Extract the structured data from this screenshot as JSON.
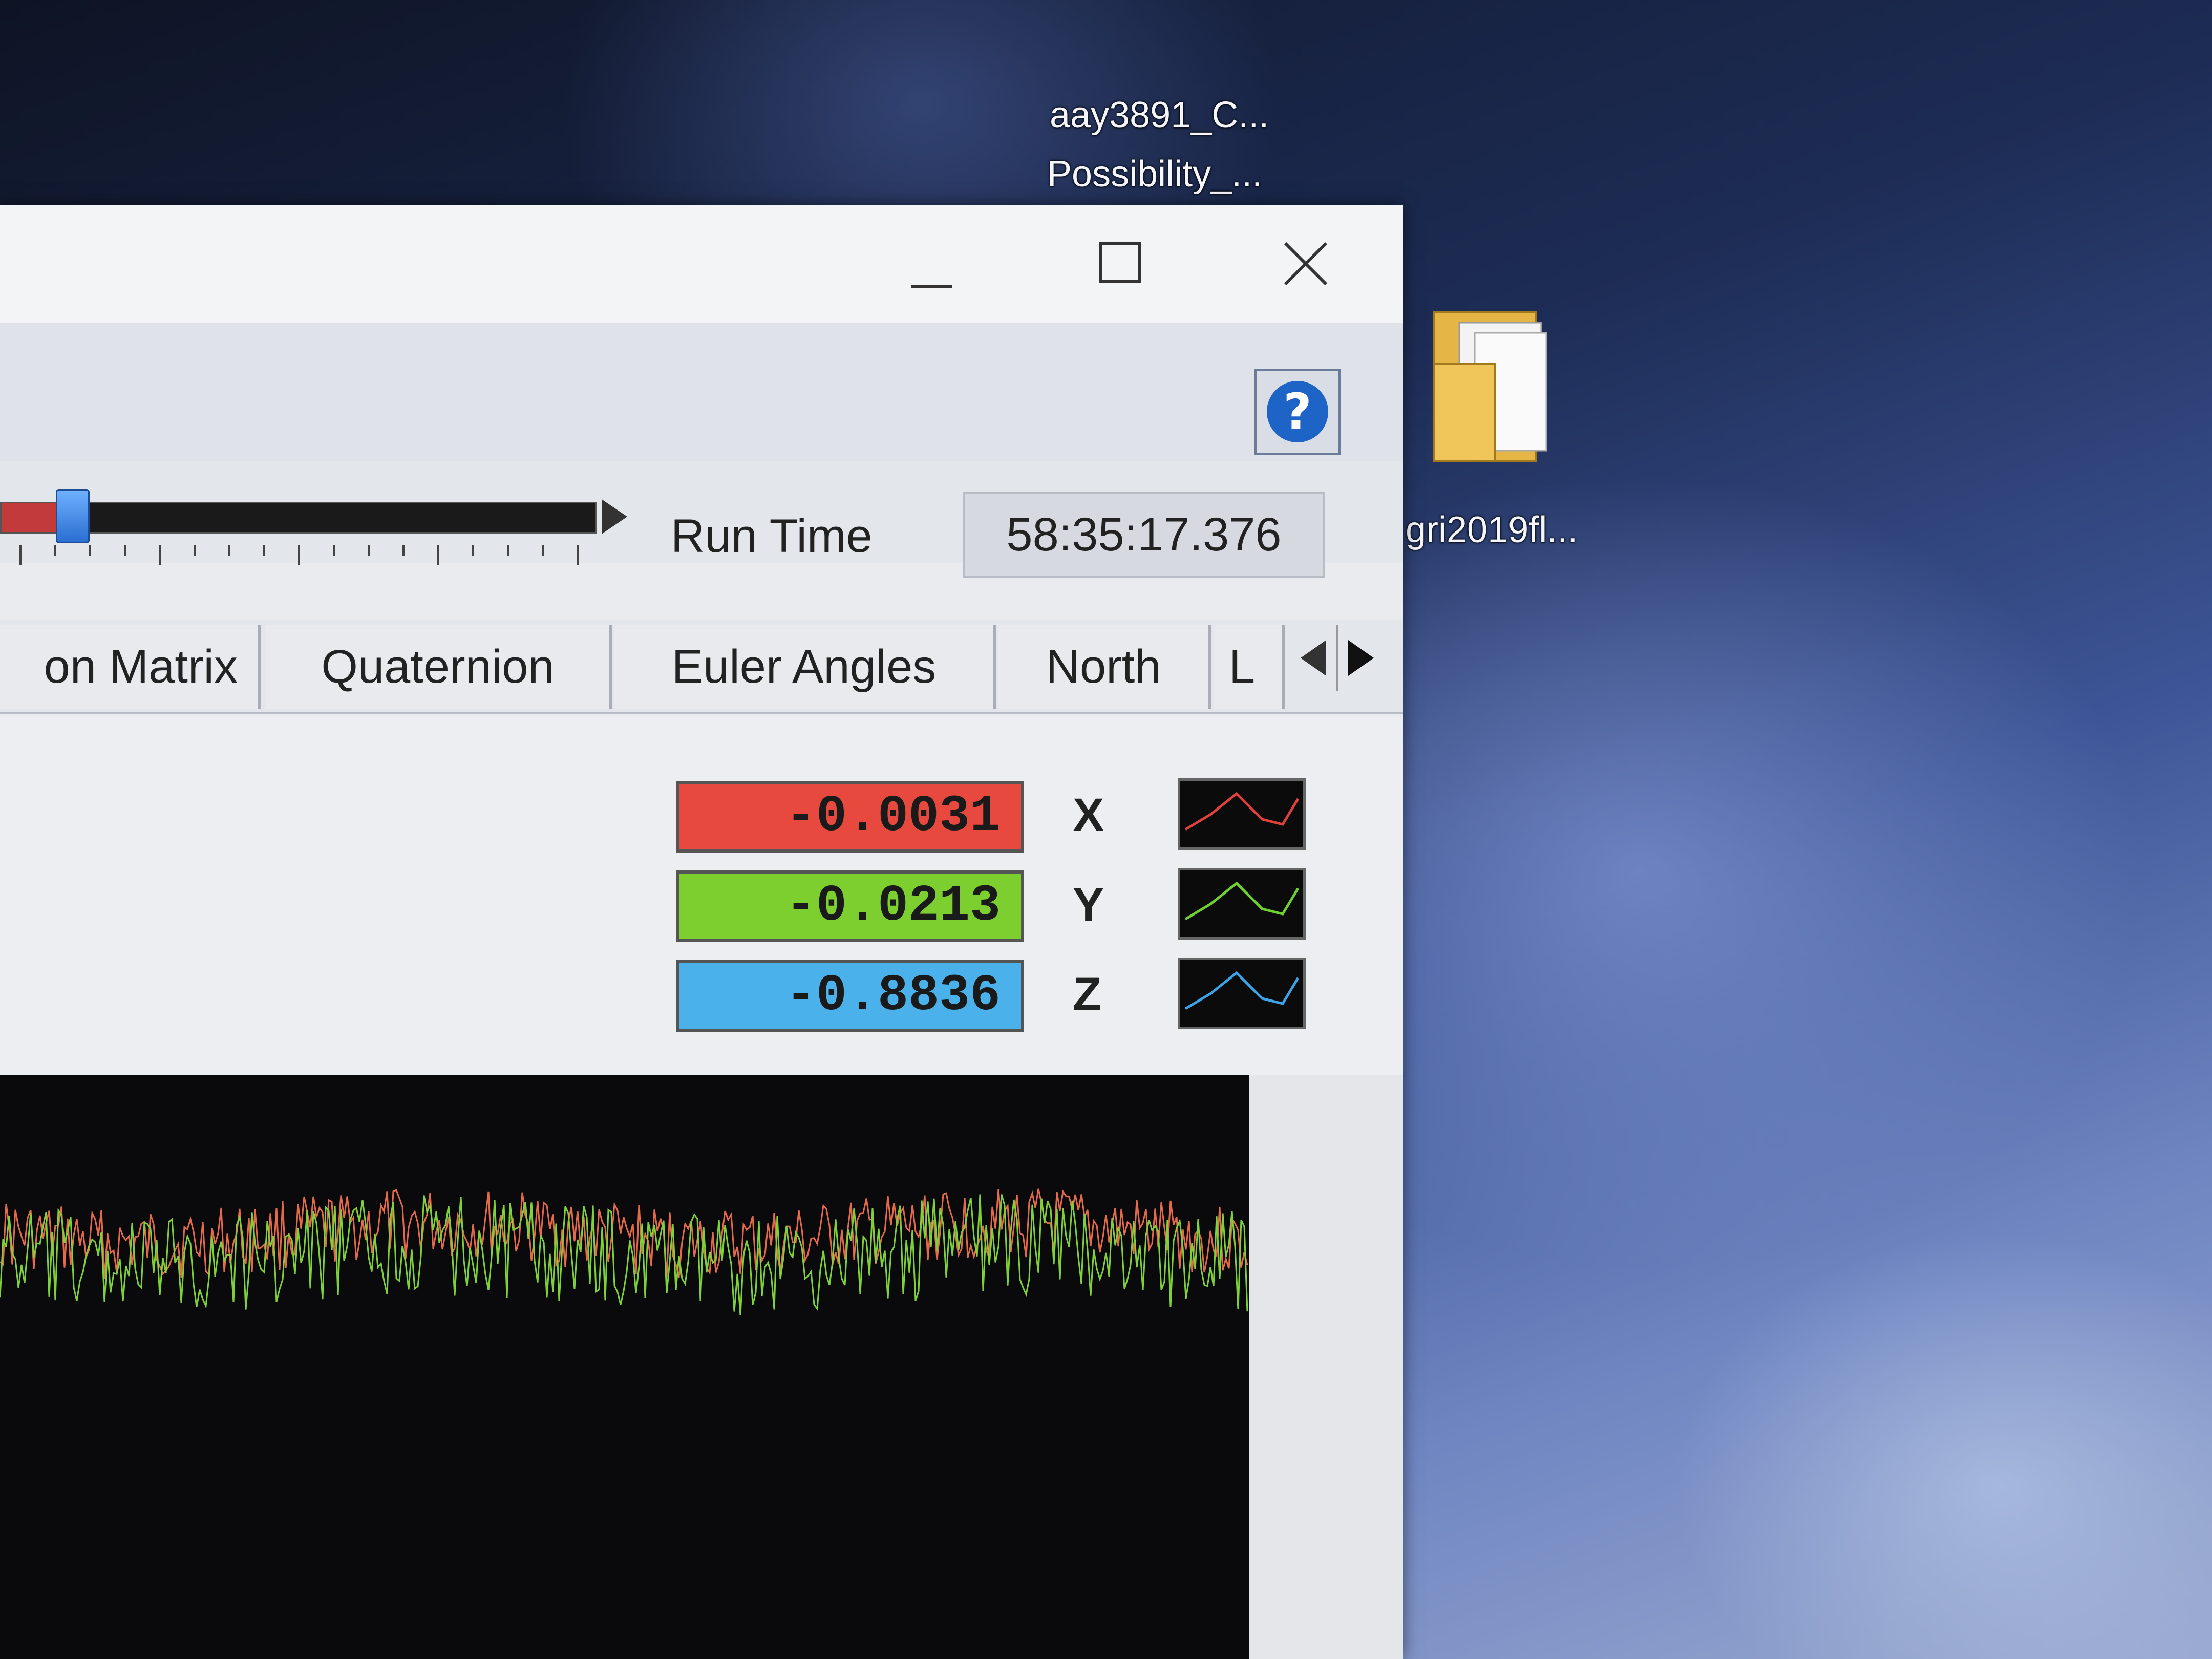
{
  "desktop": {
    "icon1_line1": "aay3891_C...",
    "icon1_line2": "Possibility_...",
    "icon2_label": "gri2019fl..."
  },
  "window": {
    "controls": [
      "minimize",
      "maximize",
      "close"
    ],
    "help_icon": "?"
  },
  "runtime": {
    "label": "Run Time",
    "value": "58:35:17.376",
    "progress_fraction": 0.12
  },
  "tabs": {
    "items": [
      "on Matrix",
      "Quaternion",
      "Euler Angles",
      "North",
      "L"
    ]
  },
  "axes": [
    {
      "label": "X",
      "value": "-0.0031",
      "color": "#e8493f"
    },
    {
      "label": "Y",
      "value": "-0.0213",
      "color": "#7ccf2f"
    },
    {
      "label": "Z",
      "value": "-0.8836",
      "color": "#4ab1ea"
    }
  ],
  "graph": {
    "series_colors": [
      "#e56a4a",
      "#7fd13a"
    ]
  }
}
